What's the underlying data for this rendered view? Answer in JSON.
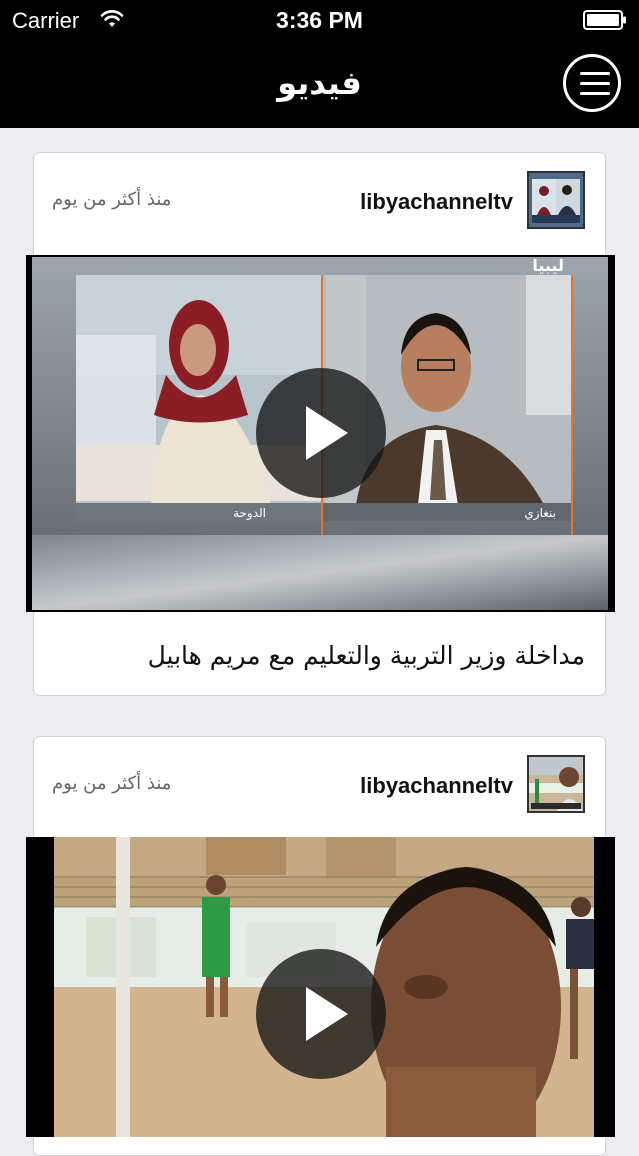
{
  "status_bar": {
    "carrier": "Carrier",
    "time": "3:36 PM",
    "wifi_icon": "wifi-icon",
    "battery_icon": "battery-icon"
  },
  "nav_bar": {
    "title": "فيديو",
    "menu_icon": "hamburger-menu-icon"
  },
  "colors": {
    "bar_background": "#000000",
    "page_background": "#ebebf0",
    "card_background": "#ffffff"
  },
  "feed": [
    {
      "channel": "libyachanneltv",
      "time_ago": "منذ أكثر من يوم",
      "title": "مداخلة وزير التربية والتعليم مع  مريم هابيل",
      "thumbnail_overlay": {
        "logo": "ليبيا",
        "left_caption": "الدوحة",
        "right_caption": "بنغازي"
      }
    },
    {
      "channel": "libyachanneltv",
      "time_ago": "منذ أكثر من يوم",
      "title": ""
    }
  ]
}
